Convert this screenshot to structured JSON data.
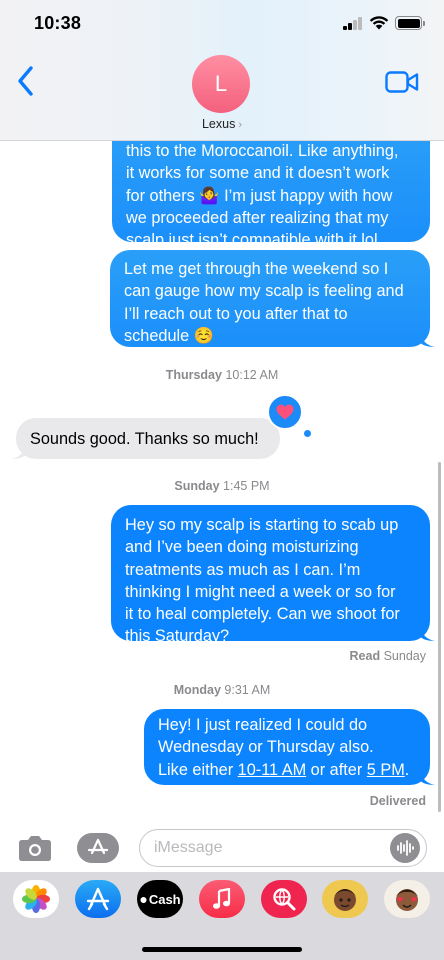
{
  "status_bar": {
    "time": "10:38"
  },
  "header": {
    "contact_initial": "L",
    "contact_name": "Lexus"
  },
  "thread": {
    "msg1": {
      "lines": [
        "this to the Moroccanoil. Like anything,",
        "it works for some and it doesn’t work",
        "for others 🤷‍♀️ I’m just happy with how",
        "we proceeded after realizing that my",
        "scalp just isn’t compatible with it lol."
      ]
    },
    "msg2": {
      "lines": [
        "Let me get through the weekend so I",
        "can gauge how my scalp is feeling and",
        "I’ll reach out to you after that to",
        "schedule ☺️"
      ]
    },
    "ts1": {
      "day": "Thursday",
      "time": "10:12 AM"
    },
    "msg3": {
      "text": "Sounds good. Thanks so much!"
    },
    "ts2": {
      "day": "Sunday",
      "time": "1:45 PM"
    },
    "msg4": {
      "lines": [
        "Hey so my scalp is starting to scab up",
        "and I’ve been doing moisturizing",
        "treatments as much as I can. I’m",
        "thinking I might need a week or so for",
        "it to heal completely. Can we shoot for"
      ],
      "link": "this Saturday",
      "after_link": "?"
    },
    "read_receipt": {
      "label": "Read",
      "day": "Sunday"
    },
    "ts3": {
      "day": "Monday",
      "time": "9:31 AM"
    },
    "msg5": {
      "line1": "Hey! I just realized I could do",
      "line2": "Wednesday or Thursday also.",
      "line3_prefix": "Like either ",
      "link1": "10-11 AM",
      "line3_middle": " or after ",
      "link2": "5 PM",
      "line3_suffix": "."
    },
    "delivered": "Delivered"
  },
  "compose": {
    "placeholder": "iMessage"
  },
  "app_drawer": {
    "cash_label": "Cash"
  },
  "colors": {
    "bubble_sent": "#0b84fe",
    "bubble_received": "#e9e9eb",
    "accent": "#0a7aff",
    "tapback_heart": "#ff4f7b"
  },
  "icons": [
    "back-chevron-icon",
    "video-camera-icon",
    "camera-icon",
    "app-store-icon",
    "audio-waveform-icon",
    "heart-icon",
    "photos-icon",
    "apple-cash-icon",
    "music-icon",
    "web-search-icon",
    "memoji-icon"
  ]
}
